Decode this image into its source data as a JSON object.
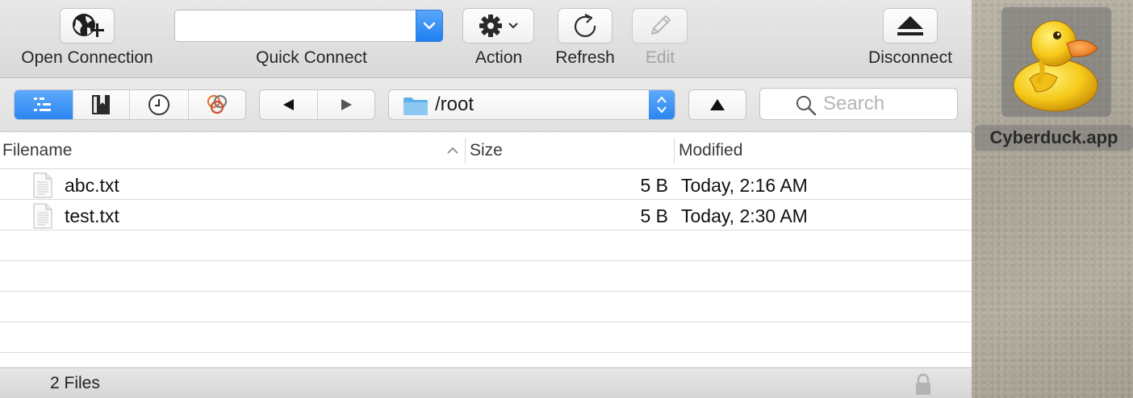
{
  "toolbar": {
    "open_connection": "Open Connection",
    "quick_connect": "Quick Connect",
    "quick_connect_value": "",
    "action": "Action",
    "refresh": "Refresh",
    "edit": "Edit",
    "disconnect": "Disconnect"
  },
  "navbar": {
    "view_segments": [
      "browser-view",
      "bookmarks",
      "history",
      "bonjour"
    ],
    "active_segment": "browser-view",
    "path": "/root",
    "search_placeholder": "Search"
  },
  "table": {
    "columns": {
      "filename": "Filename",
      "size": "Size",
      "modified": "Modified"
    },
    "sort_column": "Filename",
    "rows": [
      {
        "name": "abc.txt",
        "size": "5 B",
        "modified": "Today, 2:16 AM"
      },
      {
        "name": "test.txt",
        "size": "5 B",
        "modified": "Today, 2:30 AM"
      }
    ]
  },
  "status": {
    "file_count": "2 Files"
  },
  "desktop": {
    "app_label": "Cyberduck.app"
  },
  "colors": {
    "accent": "#2b86f2",
    "toolbar_bg": "#dcdcdc"
  }
}
